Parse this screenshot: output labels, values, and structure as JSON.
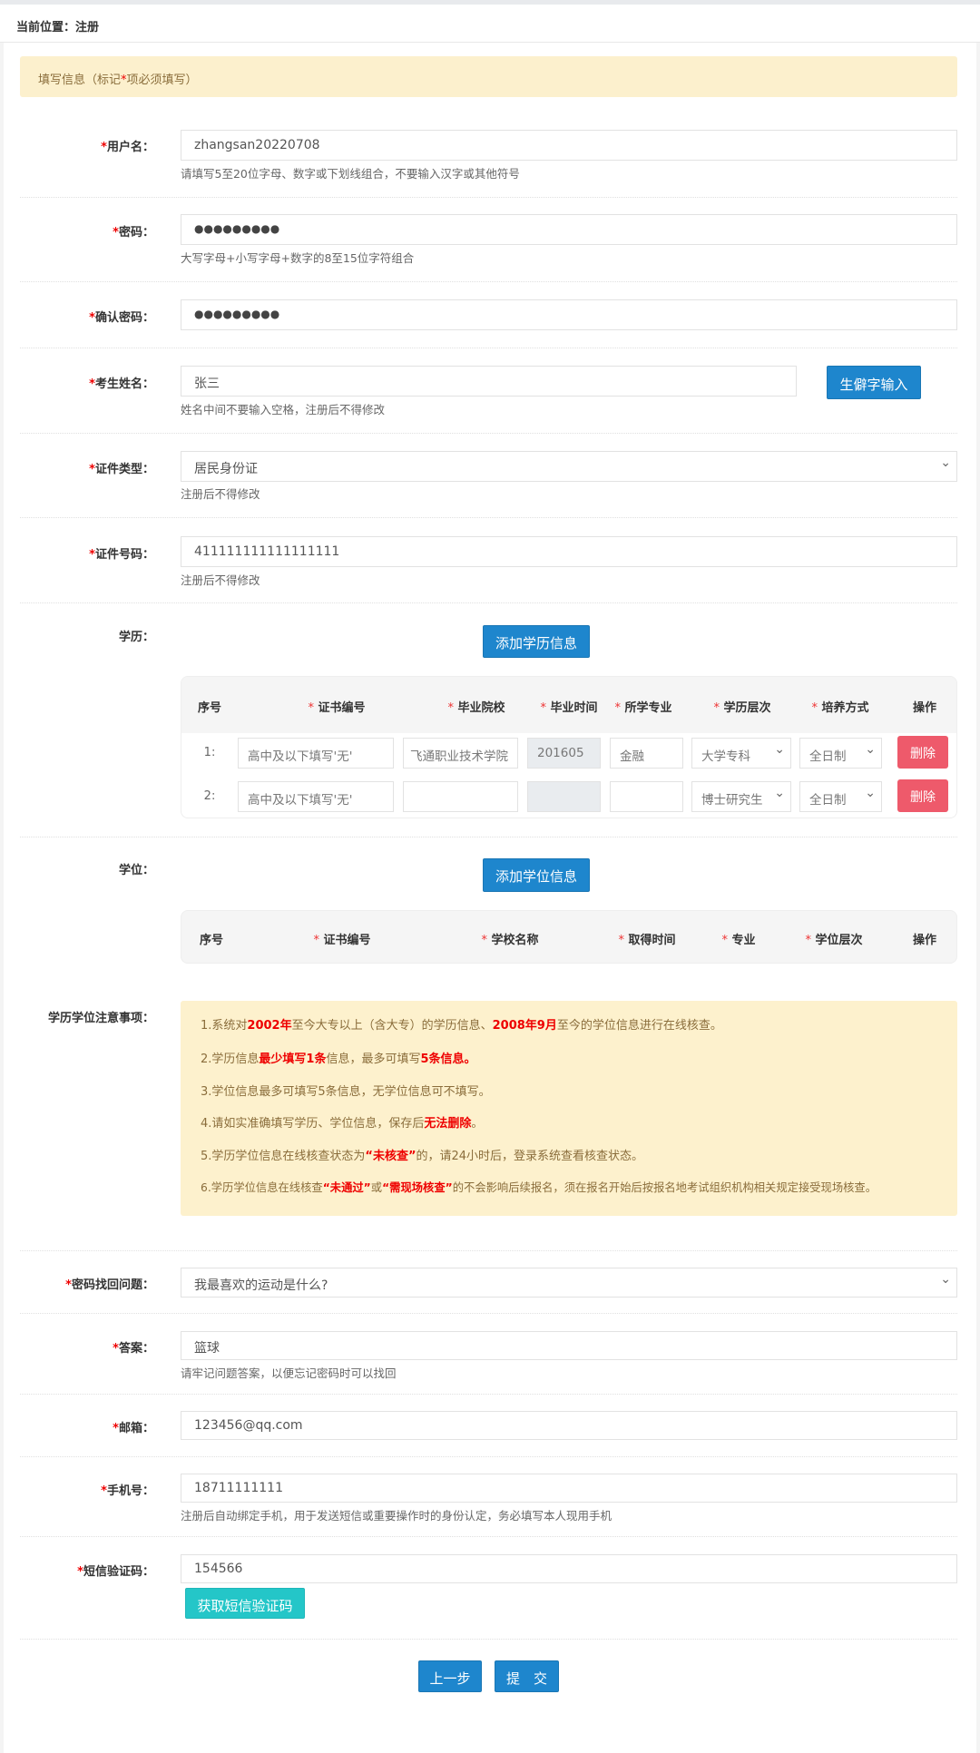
{
  "breadcrumb": "当前位置：注册",
  "notice": {
    "pre": "填写信息（标记",
    "star": "*",
    "post": "项必须填写）"
  },
  "fields": {
    "username": {
      "label": "用户名：",
      "value": "zhangsan20220708",
      "hint": "请填写5至20位字母、数字或下划线组合，不要输入汉字或其他符号"
    },
    "password": {
      "label": "密码：",
      "value": "●●●●●●●●●",
      "hint": "大写字母+小写字母+数字的8至15位字符组合"
    },
    "confirm": {
      "label": "确认密码：",
      "value": "●●●●●●●●●"
    },
    "name": {
      "label": "考生姓名：",
      "value": "张三",
      "hint": "姓名中间不要输入空格，注册后不得修改",
      "button": "生僻字输入"
    },
    "cert_type": {
      "label": "证件类型：",
      "value": "居民身份证",
      "hint": "注册后不得修改"
    },
    "cert_no": {
      "label": "证件号码：",
      "value": "411111111111111111",
      "hint": "注册后不得修改"
    },
    "question": {
      "label": "密码找回问题：",
      "value": "我最喜欢的运动是什么?"
    },
    "answer": {
      "label": "答案：",
      "value": "篮球",
      "hint": "请牢记问题答案，以便忘记密码时可以找回"
    },
    "email": {
      "label": "邮箱：",
      "value": "123456@qq.com"
    },
    "phone": {
      "label": "手机号：",
      "value": "18711111111",
      "hint": "注册后自动绑定手机，用于发送短信或重要操作时的身份认定，务必填写本人现用手机"
    },
    "sms": {
      "label": "短信验证码：",
      "value": "154566",
      "button": "获取短信验证码"
    }
  },
  "star": "*",
  "education": {
    "label": "学历：",
    "add_button": "添加学历信息",
    "headers": [
      "序号",
      "证书编号",
      "毕业院校",
      "毕业时间",
      "所学专业",
      "学历层次",
      "培养方式",
      "操作"
    ],
    "rows": [
      {
        "no": "1:",
        "cert": "高中及以下填写'无'",
        "school": "飞通职业技术学院",
        "time": "201605",
        "major": "金融",
        "level": "大学专科",
        "mode": "全日制",
        "action": "删除"
      },
      {
        "no": "2:",
        "cert": "高中及以下填写'无'",
        "school": "",
        "time": "",
        "major": "",
        "level": "博士研究生",
        "mode": "全日制",
        "action": "删除"
      }
    ]
  },
  "degree": {
    "label": "学位：",
    "add_button": "添加学位信息",
    "headers": [
      "序号",
      "证书编号",
      "学校名称",
      "取得时间",
      "专业",
      "学位层次",
      "操作"
    ]
  },
  "notes": {
    "label": "学历学位注意事项：",
    "lines": [
      [
        "1.系统对",
        "2002年",
        "至今大专以上（含大专）的学历信息、",
        "2008年9月",
        "至今的学位信息进行在线核查。"
      ],
      [
        "2.学历信息",
        "最少填写1条",
        "信息，最多可填写",
        "5条信息。",
        ""
      ],
      [
        "3.学位信息最多可填写5条信息，无学位信息可不填写。"
      ],
      [
        "4.请如实准确填写学历、学位信息，保存后",
        "无法删除",
        "。"
      ],
      [
        "5.学历学位信息在线核查状态为",
        "“未核查”",
        "的，请24小时后，登录系统查看核查状态。"
      ],
      [
        "6.学历学位信息在线核查",
        "“未通过”",
        "或",
        "“需现场核查”",
        "的不会影响后续报名，须在报名开始后按报名地考试组织机构相关规定接受现场核查。"
      ]
    ]
  },
  "actions": {
    "prev": "上一步",
    "submit": "提　交"
  }
}
